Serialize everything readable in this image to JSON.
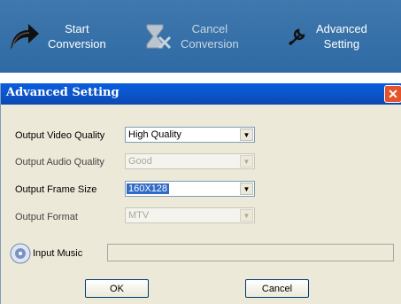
{
  "toolbar": {
    "start": {
      "line1": "Start",
      "line2": "Conversion"
    },
    "cancel": {
      "line1": "Cancel",
      "line2": "Conversion"
    },
    "advanced": {
      "line1": "Advanced",
      "line2": "Setting"
    }
  },
  "dialog": {
    "title": "Advanced Setting",
    "close_glyph": "✕",
    "fields": {
      "video_quality": {
        "label": "Output Video Quality",
        "value": "High Quality"
      },
      "audio_quality": {
        "label": "Output Audio Quality",
        "value": "Good"
      },
      "frame_size": {
        "label": "Output Frame Size",
        "value": "160X128"
      },
      "format": {
        "label": "Output Format",
        "value": "MTV"
      }
    },
    "input_music": {
      "label": "Input Music",
      "value": ""
    },
    "ok_label": "OK",
    "cancel_label": "Cancel"
  },
  "colors": {
    "toolbar": "#3f78ad",
    "titlebar": "#0a5ddf",
    "dialog_bg": "#ece9d8",
    "selection": "#316ac5"
  }
}
